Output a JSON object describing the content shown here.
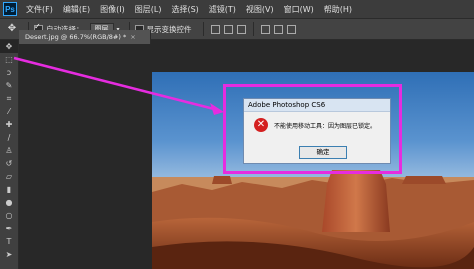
{
  "app": {
    "logo": "Ps"
  },
  "menu": [
    "文件(F)",
    "编辑(E)",
    "图像(I)",
    "图层(L)",
    "选择(S)",
    "滤镜(T)",
    "视图(V)",
    "窗口(W)",
    "帮助(H)"
  ],
  "options": {
    "auto_select_label": "自动选择：",
    "auto_select_checked": true,
    "auto_select_value": "图层",
    "transform_label": "显示变换控件",
    "transform_checked": false
  },
  "document": {
    "tab_title": "Desert.jpg @ 66.7%(RGB/8#) *",
    "close": "×"
  },
  "dialog": {
    "title": "Adobe Photoshop CS6",
    "message": "不能使用移动工具：因为图层已锁定。",
    "ok_label": "确定",
    "icon": "error-icon"
  },
  "toolbox_icons": [
    "move-icon",
    "marquee-icon",
    "lasso-icon",
    "quick-select-icon",
    "crop-icon",
    "eyedropper-icon",
    "healing-icon",
    "brush-icon",
    "stamp-icon",
    "history-brush-icon",
    "eraser-icon",
    "gradient-icon",
    "blur-icon",
    "dodge-icon",
    "pen-icon",
    "type-icon",
    "path-select-icon"
  ],
  "colors": {
    "highlight": "#e62ce0",
    "arrow": "#e62ce0",
    "error": "#d42020"
  }
}
